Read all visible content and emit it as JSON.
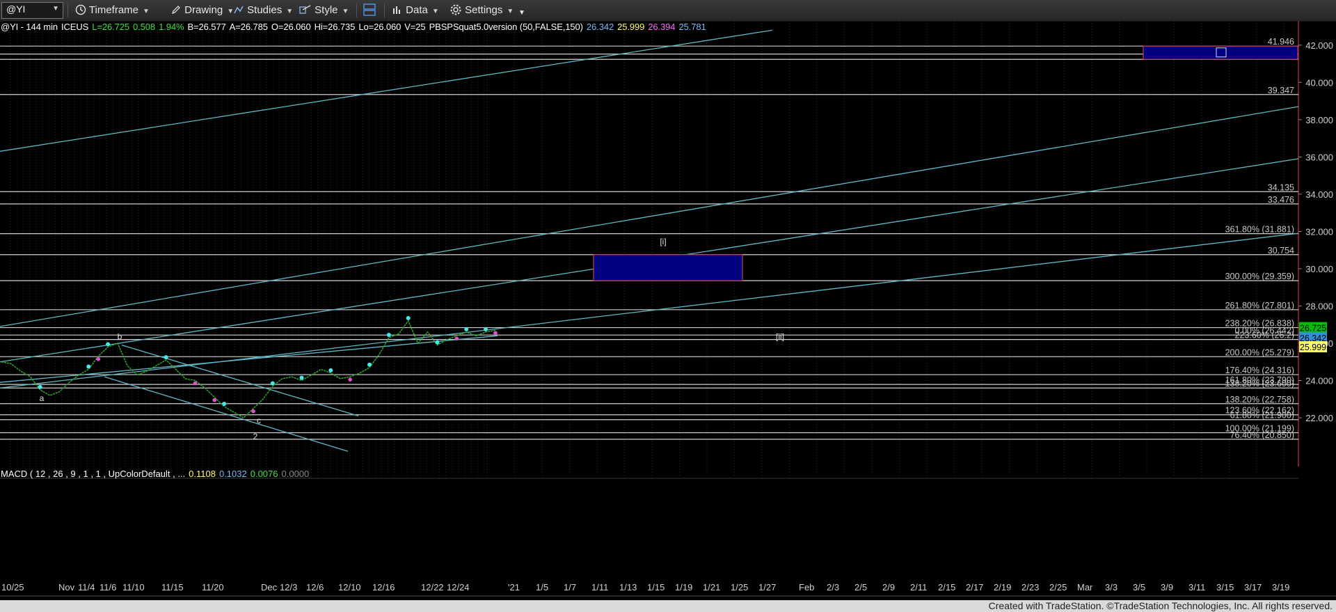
{
  "toolbar": {
    "symbol": "@YI",
    "items": [
      {
        "label": "Timeframe",
        "icon": "clock-icon"
      },
      {
        "label": "Drawing",
        "icon": "pencil-icon"
      },
      {
        "label": "Studies",
        "icon": "studies-icon"
      },
      {
        "label": "Style",
        "icon": "style-icon"
      },
      {
        "label": "Data",
        "icon": "bar-chart-icon"
      },
      {
        "label": "Settings",
        "icon": "gear-icon"
      }
    ]
  },
  "info": {
    "symbol": "@YI - 144 min",
    "exchange": "ICEUS",
    "last": "L=26.725",
    "change": "0.508",
    "change_pct": "1.94%",
    "bid": "B=26.577",
    "ask": "A=26.785",
    "open": "O=26.060",
    "high": "Hi=26.735",
    "low": "Lo=26.060",
    "volume": "V=25",
    "study": "PBSPSquat5.0version (50,FALSE,150)",
    "study_values": [
      "26.342",
      "25.999",
      "26.394",
      "25.781"
    ]
  },
  "macd": {
    "label": "MACD ( 12 , 26 , 9 , 1 , 1 , UpColorDefault , ...",
    "values": [
      "0.1108",
      "0.1032",
      "0.0076",
      "0.0000"
    ]
  },
  "colors": {
    "background": "#000000",
    "channel": "#5fb8c6",
    "hline": "#d0d0d0",
    "box_fill": "#000080",
    "box_border": "#c83c4b",
    "price_up": "#2ea82e",
    "marker_cyan": "#48e8e8",
    "marker_magenta": "#e050d0",
    "last_price": "#00c000",
    "study_1": "#2f8fd8",
    "study_2": "#ffff66"
  },
  "chart_data": {
    "type": "line",
    "title": "",
    "ylim": [
      19.2,
      43.0
    ],
    "y_ticks": [
      "42.000",
      "40.000",
      "38.000",
      "36.000",
      "34.000",
      "32.000",
      "30.000",
      "28.000",
      "26.000",
      "24.000",
      "22.000"
    ],
    "x_labels": [
      "10/25",
      "Nov",
      "11/4",
      "11/6",
      "11/10",
      "11/15",
      "11/20",
      "Dec",
      "12/3",
      "12/6",
      "12/10",
      "12/16",
      "12/22",
      "12/24",
      "'21",
      "1/5",
      "1/7",
      "1/11",
      "1/13",
      "1/15",
      "1/19",
      "1/21",
      "1/25",
      "1/27",
      "Feb",
      "2/3",
      "2/5",
      "2/9",
      "2/11",
      "2/15",
      "2/17",
      "2/19",
      "2/23",
      "2/25",
      "Mar",
      "3/3",
      "3/5",
      "3/9",
      "3/11",
      "3/15",
      "3/17",
      "3/19"
    ],
    "levels": [
      {
        "value": 41.946,
        "label": "41.946"
      },
      {
        "value": 41.52,
        "label": "41.520"
      },
      {
        "value": 41.236,
        "label": "41.236"
      },
      {
        "value": 39.347,
        "label": "39.347"
      },
      {
        "value": 34.135,
        "label": "34.135"
      },
      {
        "value": 33.476,
        "label": "33.476"
      },
      {
        "value": 31.881,
        "label": "361.80% (31.881)"
      },
      {
        "value": 30.754,
        "label": "30.754"
      },
      {
        "value": 29.359,
        "label": "300.00% (29.359)"
      },
      {
        "value": 27.801,
        "label": "261.80% (27.801)"
      },
      {
        "value": 26.838,
        "label": "238.20% (26.838)"
      },
      {
        "value": 26.442,
        "label": "0.00% (26.442)"
      },
      {
        "value": 26.2,
        "label": "223.60% (26.2)"
      },
      {
        "value": 25.279,
        "label": "200.00% (25.279)"
      },
      {
        "value": 24.316,
        "label": "176.40% (24.316)"
      },
      {
        "value": 23.79,
        "label": "161.80% (23.790)"
      },
      {
        "value": 23.6,
        "label": "138.20% (23.600)"
      },
      {
        "value": 22.758,
        "label": "138.20% (22.758)"
      },
      {
        "value": 22.162,
        "label": "123.60% (22.162)"
      },
      {
        "value": 21.9,
        "label": "61.80% (21.900)"
      },
      {
        "value": 21.199,
        "label": "100.00% (21.199)"
      },
      {
        "value": 20.85,
        "label": "76.40% (20.850)"
      }
    ],
    "axis_tags": [
      {
        "value": 26.725,
        "label": "26.725",
        "color": "#00c000"
      },
      {
        "value": 26.342,
        "label": "26.342",
        "color": "#2f8fd8"
      },
      {
        "value": 25.999,
        "label": "25.999",
        "color": "#ffff66"
      }
    ],
    "wave_labels": [
      "a",
      "b",
      "c",
      "2",
      "[i]",
      "[ii]"
    ],
    "price_series": [
      25.0,
      24.9,
      24.5,
      24.2,
      23.5,
      23.2,
      23.4,
      23.9,
      24.3,
      24.6,
      25.3,
      25.8,
      26.0,
      24.8,
      24.3,
      24.5,
      24.8,
      25.1,
      24.6,
      24.1,
      24.0,
      23.6,
      23.1,
      22.6,
      22.3,
      22.0,
      22.5,
      23.0,
      23.7,
      24.1,
      24.2,
      24.0,
      24.3,
      24.6,
      24.4,
      24.1,
      24.2,
      24.4,
      24.7,
      25.4,
      26.3,
      26.5,
      27.2,
      26.0,
      26.6,
      25.9,
      26.2,
      26.4,
      26.6,
      26.4,
      26.6,
      26.7
    ]
  }
}
